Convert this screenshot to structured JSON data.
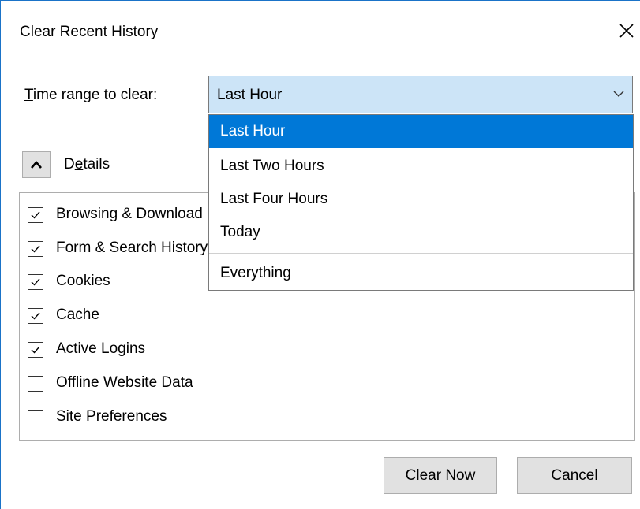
{
  "dialog": {
    "title": "Clear Recent History"
  },
  "time_range": {
    "label_prefix": "T",
    "label_rest": "ime range to clear:",
    "selected": "Last Hour",
    "options": [
      "Last Hour",
      "Last Two Hours",
      "Last Four Hours",
      "Today",
      "Everything"
    ]
  },
  "details": {
    "label_prefix": "D",
    "label_accel": "e",
    "label_rest": "tails"
  },
  "items": [
    {
      "label": "Browsing & Download History",
      "checked": true
    },
    {
      "label": "Form & Search History",
      "checked": true
    },
    {
      "label": "Cookies",
      "checked": true
    },
    {
      "label": "Cache",
      "checked": true
    },
    {
      "label": "Active Logins",
      "checked": true
    },
    {
      "label": "Offline Website Data",
      "checked": false
    },
    {
      "label": "Site Preferences",
      "checked": false
    }
  ],
  "buttons": {
    "clear_now": "Clear Now",
    "cancel": "Cancel"
  },
  "colors": {
    "select_bg": "#cce4f7",
    "highlight": "#0078d7",
    "frame": "#1a73c8"
  }
}
